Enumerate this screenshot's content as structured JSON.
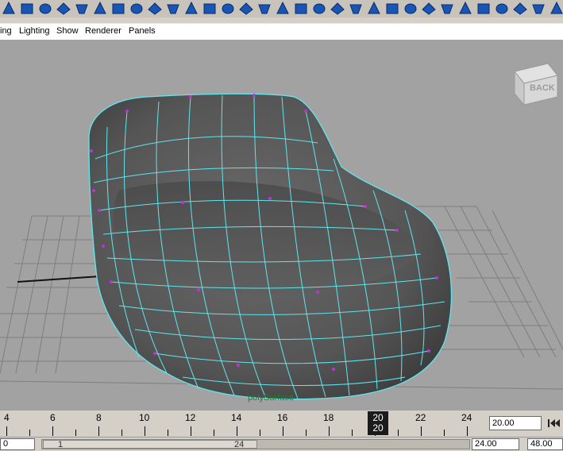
{
  "panel_menu": {
    "items": [
      "ing",
      "Lighting",
      "Show",
      "Renderer",
      "Panels"
    ]
  },
  "viewcube": {
    "label": "BACK"
  },
  "object_label": "polySurface",
  "timeline": {
    "ticks": [
      "4",
      "6",
      "8",
      "10",
      "12",
      "14",
      "16",
      "18",
      "20",
      "22",
      "24"
    ],
    "current_frame_top": "20",
    "current_frame_bottom": "20",
    "current_time": "20.00",
    "go_to_start_icon": "go-to-start-icon"
  },
  "range": {
    "start_value": "0",
    "slider_start": "1",
    "slider_end": "24",
    "end_value": "24.00",
    "anim_end": "48.00"
  },
  "colors": {
    "viewport_bg": "#a2a2a2",
    "wire": "#5fe6ee",
    "vertex": "#c032d8",
    "surface": "#545454",
    "shelf_icon_blue": "#1855b5"
  }
}
